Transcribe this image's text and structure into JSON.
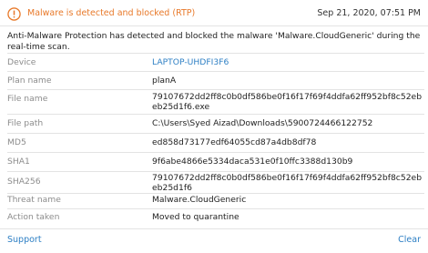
{
  "header": {
    "title": "Malware is detected and blocked (RTP)",
    "timestamp": "Sep 21, 2020, 07:51 PM",
    "icon": "warning-circle-icon",
    "accent_color": "#e8792a"
  },
  "description": "Anti-Malware Protection has detected and blocked the malware 'Malware.CloudGeneric' during the real-time scan.",
  "details": [
    {
      "label": "Device",
      "value": "LAPTOP-UHDFI3F6",
      "is_link": true
    },
    {
      "label": "Plan name",
      "value": "planA",
      "is_link": false
    },
    {
      "label": "File name",
      "value": "79107672dd2ff8c0b0df586be0f16f17f69f4ddfa62ff952bf8c52ebeb25d1f6.exe",
      "is_link": false
    },
    {
      "label": "File path",
      "value": "C:\\Users\\Syed Aizad\\Downloads\\5900724466122752",
      "is_link": false
    },
    {
      "label": "MD5",
      "value": "ed858d73177edf64055cd87a4db8df78",
      "is_link": false
    },
    {
      "label": "SHA1",
      "value": "9f6abe4866e5334daca531e0f10ffc3388d130b9",
      "is_link": false
    },
    {
      "label": "SHA256",
      "value": "79107672dd2ff8c0b0df586be0f16f17f69f4ddfa62ff952bf8c52ebeb25d1f6",
      "is_link": false
    },
    {
      "label": "Threat name",
      "value": "Malware.CloudGeneric",
      "is_link": false
    },
    {
      "label": "Action taken",
      "value": "Moved to quarantine",
      "is_link": false
    }
  ],
  "footer": {
    "support_label": "Support",
    "clear_label": "Clear",
    "link_color": "#2d7fc4"
  }
}
